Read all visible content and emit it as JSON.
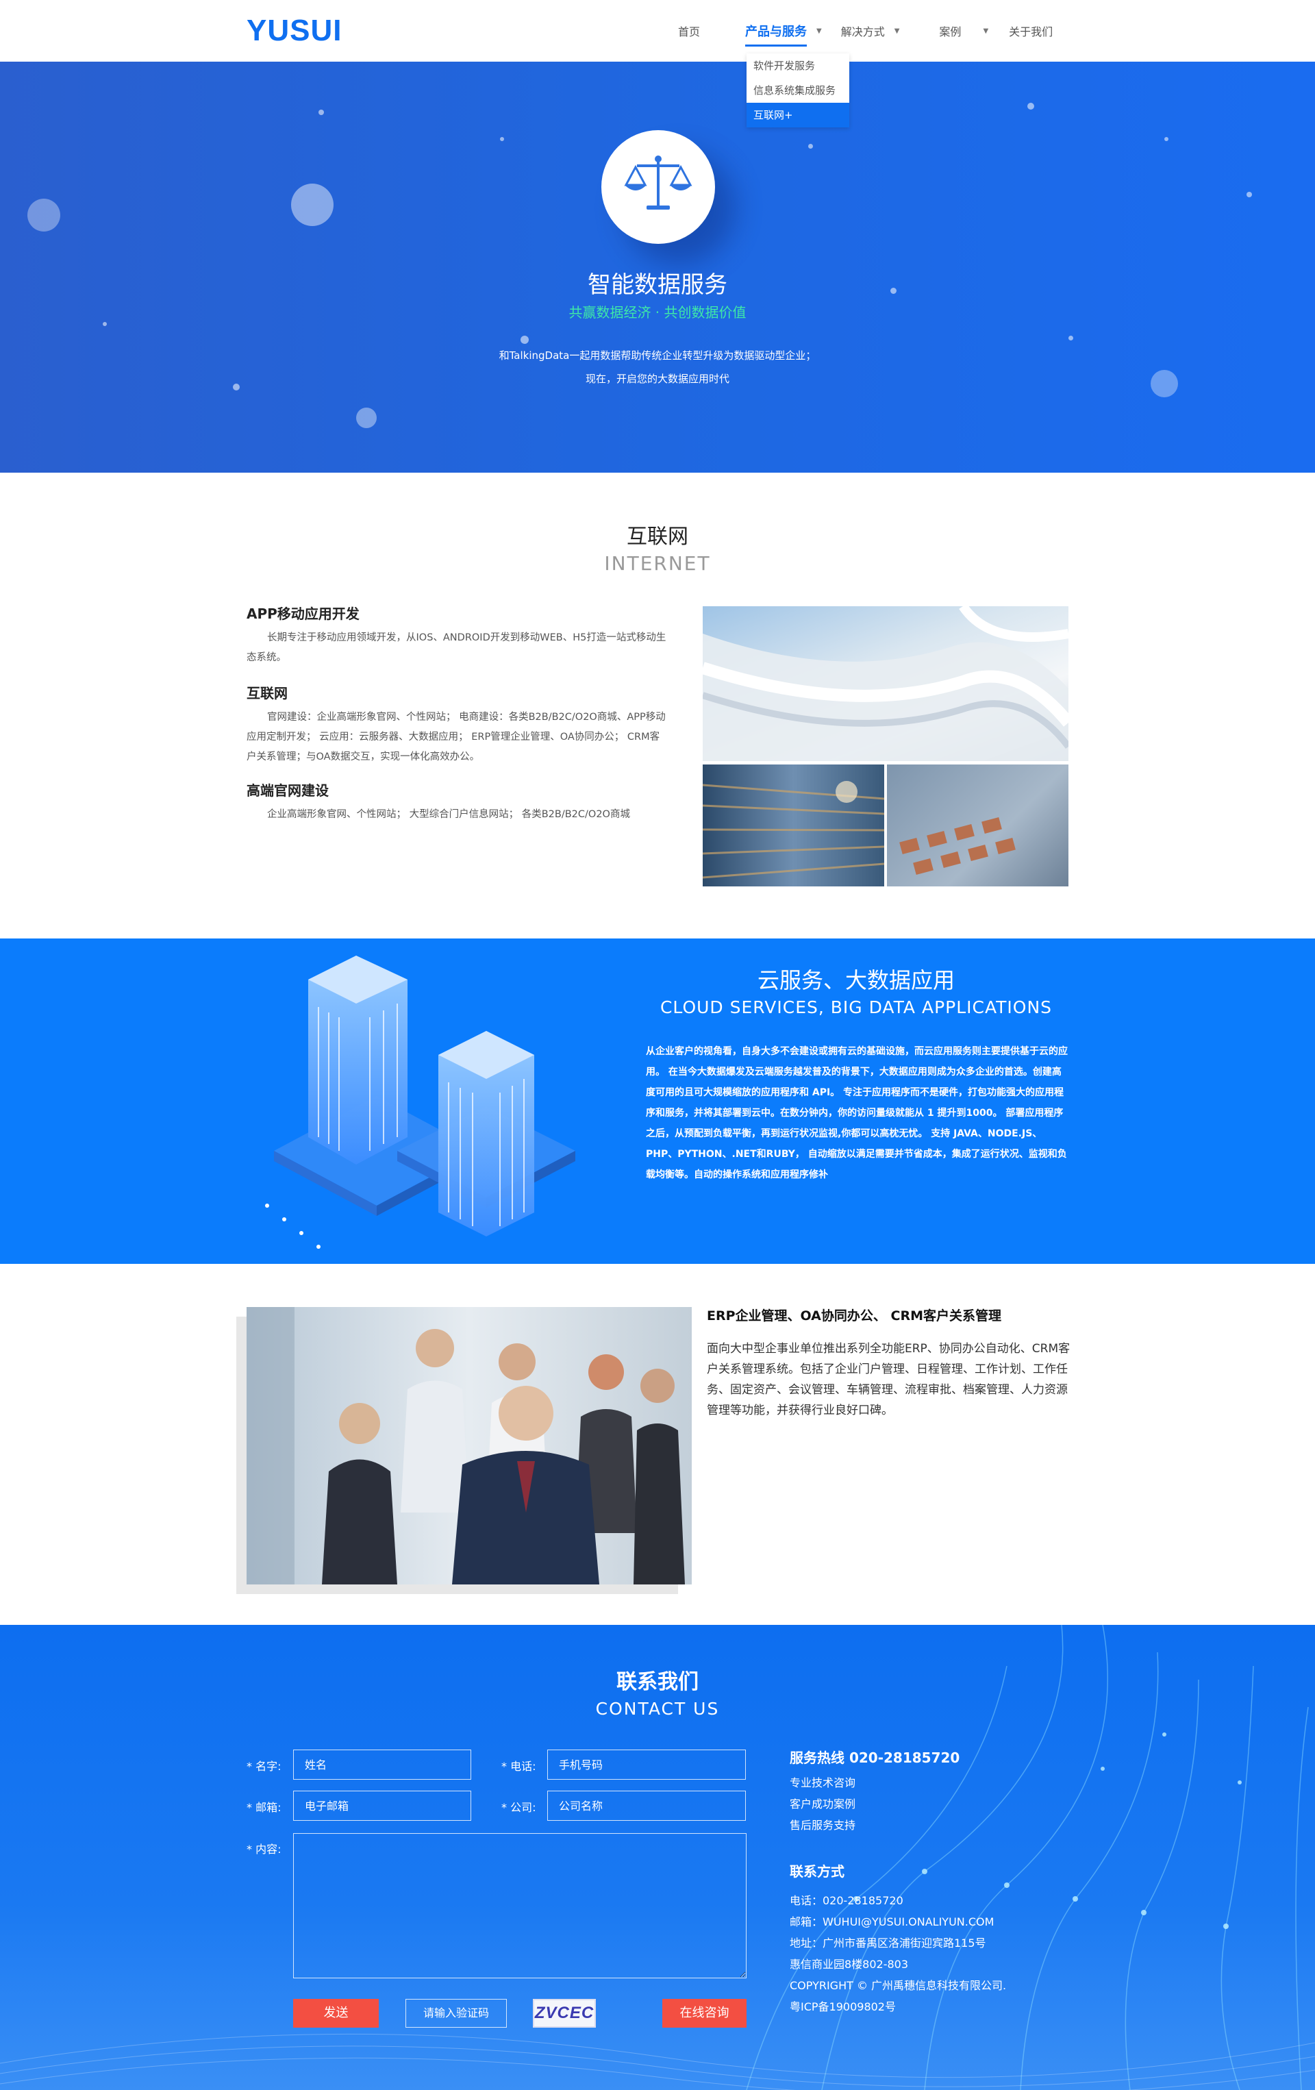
{
  "header": {
    "logo": "YUSUI",
    "nav": [
      {
        "label": "首页"
      },
      {
        "label": "产品与服务"
      },
      {
        "label": "解决方式"
      },
      {
        "label": "案例"
      },
      {
        "label": "关于我们"
      }
    ],
    "dropdown": [
      "软件开发服务",
      "信息系统集成服务",
      "互联网+"
    ]
  },
  "hero": {
    "icon": "scale-icon",
    "title": "智能数据服务",
    "subtitle": "共赢数据经济 · 共创数据价值",
    "desc_line1": "和TalkingData一起用数据帮助传统企业转型升级为数据驱动型企业；",
    "desc_line2": "现在，开启您的大数据应用时代"
  },
  "internet": {
    "title": "互联网",
    "title_en": "INTERNET",
    "blocks": [
      {
        "heading": "APP移动应用开发",
        "text": "长期专注于移动应用领域开发，从IOS、ANDROID开发到移动WEB、H5打造一站式移动生态系统。"
      },
      {
        "heading": "互联网",
        "text": "官网建设：企业高端形象官网、个性网站； 电商建设：各类B2B/B2C/O2O商城、APP移动应用定制开发； 云应用：云服务器、大数据应用； ERP管理企业管理、OA协同办公； CRM客户关系管理；与OA数据交互，实现一体化高效办公。"
      },
      {
        "heading": "高端官网建设",
        "text": "企业高端形象官网、个性网站； 大型综合门户信息网站； 各类B2B/B2C/O2O商城"
      }
    ]
  },
  "cloud": {
    "title": "云服务、大数据应用",
    "title_en": "CLOUD SERVICES, BIG DATA APPLICATIONS",
    "desc": "从企业客户的视角看，自身大多不会建设或拥有云的基础设施，而云应用服务则主要提供基于云的应用。 在当今大数据爆发及云端服务越发普及的背景下，大数据应用则成为众多企业的首选。创建高度可用的且可大规模缩放的应用程序和 API。 专注于应用程序而不是硬件，打包功能强大的应用程序和服务，并将其部署到云中。在数分钟内，你的访问量级就能从 1 提升到1000。 部署应用程序之后，从预配到负载平衡，再到运行状况监视,你都可以高枕无忧。 支持 JAVA、NODE.JS、PHP、PYTHON、.NET和RUBY， 自动缩放以满足需要并节省成本，集成了运行状况、监视和负载均衡等。自动的操作系统和应用程序修补"
  },
  "erp": {
    "title": "ERP企业管理、OA协同办公、 CRM客户关系管理",
    "desc": "面向大中型企事业单位推出系列全功能ERP、协同办公自动化、CRM客户关系管理系统。包括了企业门户管理、日程管理、工作计划、工作任务、固定资产、会议管理、车辆管理、流程审批、档案管理、人力资源管理等功能，并获得行业良好口碑。"
  },
  "contact": {
    "title": "联系我们",
    "title_en": "CONTACT US",
    "form": {
      "name_label": "* 名字:",
      "name_placeholder": "姓名",
      "phone_label": "* 电话:",
      "phone_placeholder": "手机号码",
      "email_label": "* 邮箱:",
      "email_placeholder": "电子邮箱",
      "company_label": "* 公司:",
      "company_placeholder": "公司名称",
      "content_label": "* 内容:",
      "send_button": "发送",
      "captcha_placeholder": "请输入验证码",
      "captcha_text": "ZVCEC",
      "consult_button": "在线咨询"
    },
    "hotline": "服务热线 020-28185720",
    "services": [
      "专业技术咨询",
      "客户成功案例",
      "售后服务支持"
    ],
    "method_title": "联系方式",
    "details": [
      "电话：020-28185720",
      "邮箱：WUHUI@YUSUI.ONALIYUN.COM",
      "地址：广州市番禺区洛浦街迎宾路115号",
      "惠信商业园8楼802-803",
      "COPYRIGHT © 广州禹穗信息科技有限公司.",
      "粤ICP备19009802号"
    ]
  },
  "colors": {
    "brand": "#0f6ff0",
    "cloud_bg": "#0b7cfc",
    "accent_green": "#3ee8a8",
    "button_red": "#f34f42"
  }
}
